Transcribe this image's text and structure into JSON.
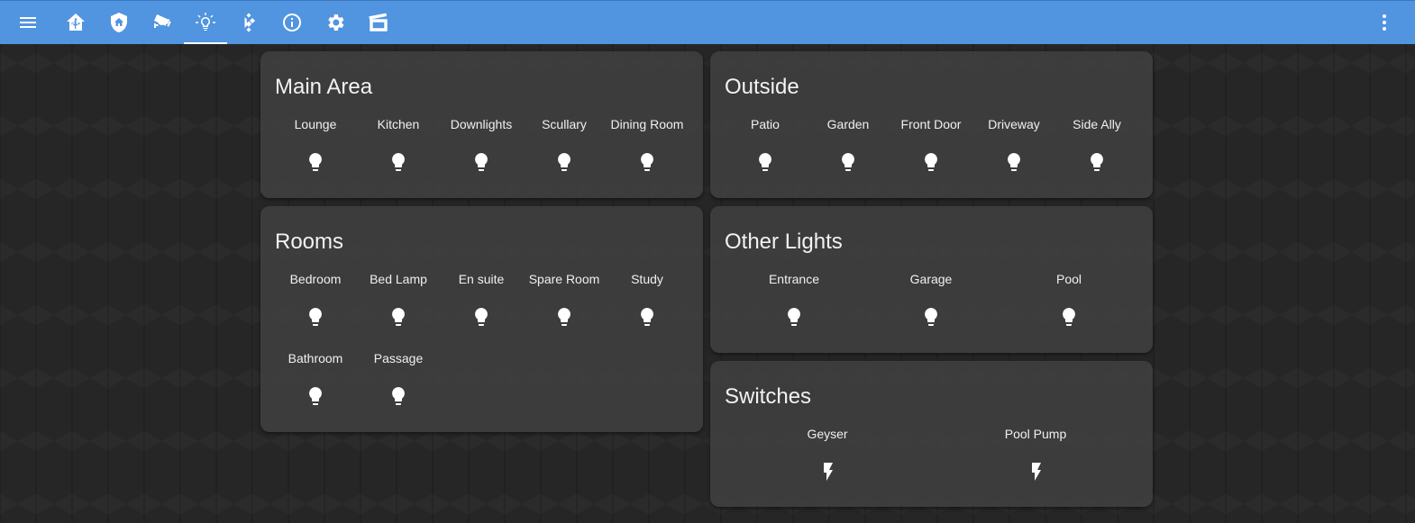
{
  "toolbar": {
    "icons": [
      "menu-icon",
      "home-assistant-icon",
      "shield-home-icon",
      "cctv-icon",
      "lightbulb-outline-icon",
      "kodi-icon",
      "info-icon",
      "gear-icon",
      "movie-clapperboard-icon",
      "dots-vertical-icon"
    ],
    "active_tab": "lightbulb-outline-icon",
    "accent_color": "#5194e0"
  },
  "cards": {
    "main_area": {
      "title": "Main Area",
      "entities": [
        {
          "name": "Lounge",
          "icon": "lightbulb-icon"
        },
        {
          "name": "Kitchen",
          "icon": "lightbulb-icon"
        },
        {
          "name": "Downlights",
          "icon": "lightbulb-icon"
        },
        {
          "name": "Scullary",
          "icon": "lightbulb-icon"
        },
        {
          "name": "Dining Room",
          "icon": "lightbulb-icon"
        }
      ]
    },
    "outside": {
      "title": "Outside",
      "entities": [
        {
          "name": "Patio",
          "icon": "lightbulb-icon"
        },
        {
          "name": "Garden",
          "icon": "lightbulb-icon"
        },
        {
          "name": "Front Door",
          "icon": "lightbulb-icon"
        },
        {
          "name": "Driveway",
          "icon": "lightbulb-icon"
        },
        {
          "name": "Side Ally",
          "icon": "lightbulb-icon"
        }
      ]
    },
    "rooms": {
      "title": "Rooms",
      "entities": [
        {
          "name": "Bedroom",
          "icon": "lightbulb-icon"
        },
        {
          "name": "Bed Lamp",
          "icon": "lightbulb-icon"
        },
        {
          "name": "En suite",
          "icon": "lightbulb-icon"
        },
        {
          "name": "Spare Room",
          "icon": "lightbulb-icon"
        },
        {
          "name": "Study",
          "icon": "lightbulb-icon"
        },
        {
          "name": "Bathroom",
          "icon": "lightbulb-icon"
        },
        {
          "name": "Passage",
          "icon": "lightbulb-icon"
        }
      ]
    },
    "other_lights": {
      "title": "Other Lights",
      "entities": [
        {
          "name": "Entrance",
          "icon": "lightbulb-icon"
        },
        {
          "name": "Garage",
          "icon": "lightbulb-icon"
        },
        {
          "name": "Pool",
          "icon": "lightbulb-icon"
        }
      ]
    },
    "switches": {
      "title": "Switches",
      "entities": [
        {
          "name": "Geyser",
          "icon": "flash-icon"
        },
        {
          "name": "Pool Pump",
          "icon": "flash-icon"
        }
      ]
    }
  }
}
